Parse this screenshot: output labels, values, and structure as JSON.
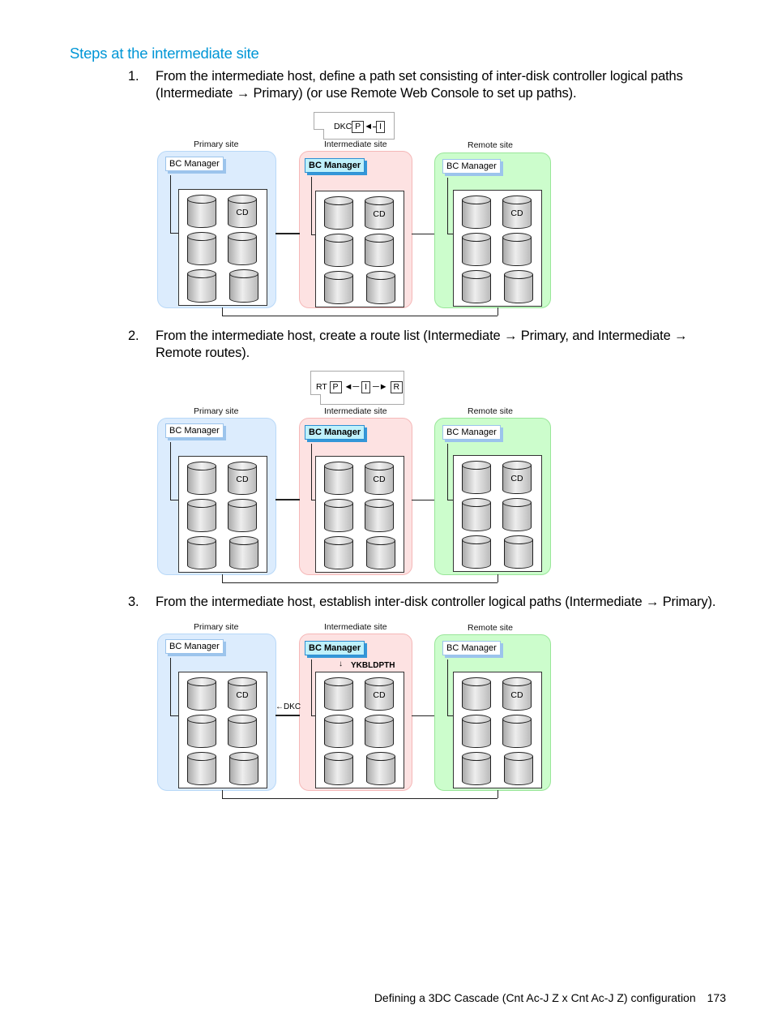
{
  "heading": "Steps at the intermediate site",
  "steps": [
    {
      "num": "1.",
      "text": "From the intermediate host, define a path set consisting of inter-disk controller logical paths (Intermediate → Primary) (or use Remote Web Console to set up paths)."
    },
    {
      "num": "2.",
      "text": "From the intermediate host, create a route list (Intermediate → Primary, and Intermediate → Remote routes)."
    },
    {
      "num": "3.",
      "text": "From the intermediate host, establish inter-disk controller logical paths (Intermediate → Primary)."
    }
  ],
  "diagram": {
    "sites": {
      "primary": "Primary site",
      "intermediate": "Intermediate site",
      "remote": "Remote site"
    },
    "bc_manager": "BC Manager",
    "cd_label": "CD",
    "fig1_note": {
      "label": "DKC",
      "from": "P",
      "to": "I",
      "arrow": "◄"
    },
    "fig2_note": {
      "label": "RT",
      "p": "P",
      "i": "I",
      "r": "R"
    },
    "fig3": {
      "command": "YKBLDPTH",
      "dkc_arrow": "←DKC",
      "cmd_arrow": "↓"
    }
  },
  "colors": {
    "heading": "#0096d6",
    "primary_site": "#dcecfd",
    "intermediate_site": "#fde2e2",
    "remote_site": "#ccfdcc",
    "active_bcm": "#bff1fb"
  },
  "footer": {
    "title": "Defining a 3DC Cascade (Cnt Ac-J Z x Cnt Ac-J Z) configuration",
    "page": "173"
  }
}
